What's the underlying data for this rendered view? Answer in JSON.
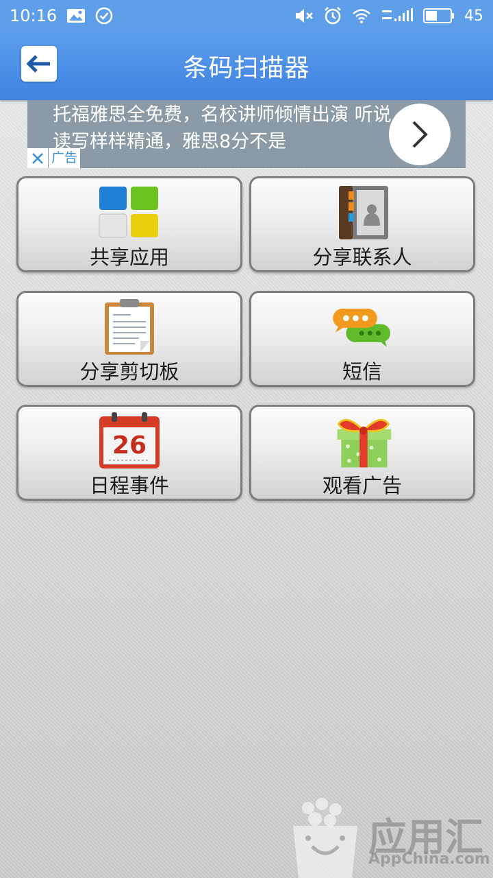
{
  "status_bar": {
    "time": "10:16",
    "battery": "45",
    "icons": [
      "image-icon",
      "check-circle-icon",
      "mute-icon",
      "alarm-icon",
      "wifi-icon",
      "signal-icon",
      "battery-icon"
    ]
  },
  "header": {
    "title": "条码扫描器",
    "back_icon": "back-arrow-icon"
  },
  "ad": {
    "text": "托福雅思全免费，名校讲师倾情出演 听说读写样样精通，雅思8分不是",
    "tag": "广告",
    "close_icon": "close-icon",
    "arrow_icon": "chevron-right-icon"
  },
  "tiles": [
    {
      "label": "共享应用",
      "icon": "apps-grid-icon"
    },
    {
      "label": "分享联系人",
      "icon": "contacts-book-icon"
    },
    {
      "label": "分享剪切板",
      "icon": "clipboard-icon"
    },
    {
      "label": "短信",
      "icon": "chat-bubbles-icon"
    },
    {
      "label": "日程事件",
      "icon": "calendar-icon"
    },
    {
      "label": "观看广告",
      "icon": "gift-box-icon"
    }
  ],
  "calendar_day": "26",
  "watermark": {
    "text": "应用汇",
    "url": "AppChina.com"
  },
  "colors": {
    "statusbar": "#5f9fe9",
    "titlebar": "#3f82e0",
    "ad_background": "#8a9aa6"
  }
}
